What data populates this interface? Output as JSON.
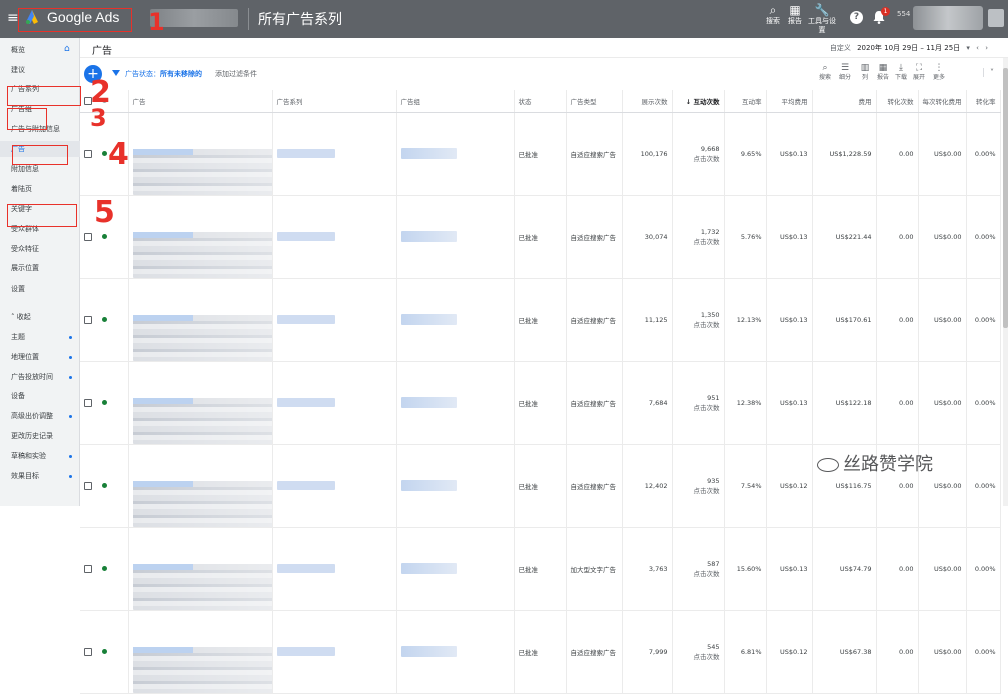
{
  "topbar": {
    "menu_glyph": "≡",
    "brand": "Google Ads",
    "page_title": "所有广告系列",
    "tools": [
      {
        "icon": "search-icon",
        "glyph": "⌕",
        "label": "搜索"
      },
      {
        "icon": "reports-icon",
        "glyph": "▦",
        "label": "报告"
      },
      {
        "icon": "wrench-icon",
        "glyph": "🔧",
        "label": "工具与设置"
      }
    ],
    "help_glyph": "?",
    "notification_count": "1",
    "customer_id_prefix": "554"
  },
  "sidebar": {
    "items": [
      {
        "label": "概览",
        "dot": false
      },
      {
        "label": "建议",
        "dot": false
      },
      {
        "label": "广告系列",
        "dot": false
      },
      {
        "label": "广告组",
        "dot": false
      },
      {
        "label": "广告与附加信息",
        "dot": false
      },
      {
        "label": "广告",
        "dot": false
      },
      {
        "label": "附加信息",
        "dot": false
      },
      {
        "label": "着陆页",
        "dot": false
      },
      {
        "label": "关键字",
        "dot": false
      },
      {
        "label": "受众群体",
        "dot": false
      },
      {
        "label": "受众特征",
        "dot": false
      },
      {
        "label": "展示位置",
        "dot": false
      },
      {
        "label": "设置",
        "dot": false
      },
      {
        "label": "˄ 收起",
        "dot": false
      },
      {
        "label": "主题",
        "dot": true
      },
      {
        "label": "地理位置",
        "dot": true
      },
      {
        "label": "广告投放时间",
        "dot": true
      },
      {
        "label": "设备",
        "dot": false
      },
      {
        "label": "高级出价调整",
        "dot": true
      },
      {
        "label": "更改历史记录",
        "dot": false
      },
      {
        "label": "草稿和实验",
        "dot": true
      },
      {
        "label": "效果目标",
        "dot": true
      }
    ]
  },
  "header": {
    "title": "广告",
    "date_label": "自定义",
    "date_range": "2020年 10月 29日 – 11月 25日",
    "date_dropdown": "▾",
    "prev": "‹",
    "next": "›"
  },
  "filters": {
    "add_glyph": "+",
    "status_label": "广告状态：",
    "status_value": "所有未移除的",
    "add_filter": "添加过滤条件"
  },
  "toolbar": [
    {
      "icon": "search-icon",
      "glyph": "⌕",
      "label": "搜索"
    },
    {
      "icon": "segment-icon",
      "glyph": "☰",
      "label": "细分"
    },
    {
      "icon": "columns-icon",
      "glyph": "▥",
      "label": "列"
    },
    {
      "icon": "reports-icon",
      "glyph": "▦",
      "label": "报告"
    },
    {
      "icon": "download-icon",
      "glyph": "⤓",
      "label": "下载"
    },
    {
      "icon": "expand-icon",
      "glyph": "⛶",
      "label": "展开"
    },
    {
      "icon": "more-icon",
      "glyph": "⋮",
      "label": "更多"
    }
  ],
  "collapse_glyph": "˅",
  "table": {
    "headers": [
      "广告",
      "广告系列",
      "广告组",
      "状态",
      "广告类型",
      "展示次数",
      "↓ 互动次数",
      "互动率",
      "平均费用",
      "费用",
      "转化次数",
      "每次转化费用",
      "转化率"
    ],
    "rows": [
      {
        "status": "已批准",
        "type": "自适应搜索广告",
        "impr": "100,176",
        "inter": "9,668",
        "inter_type": "点击次数",
        "rate": "9.65%",
        "avg": "US$0.13",
        "cost": "US$1,228.59",
        "conv": "0.00",
        "cpc": "US$0.00",
        "cr": "0.00%"
      },
      {
        "status": "已批准",
        "type": "自适应搜索广告",
        "impr": "30,074",
        "inter": "1,732",
        "inter_type": "点击次数",
        "rate": "5.76%",
        "avg": "US$0.13",
        "cost": "US$221.44",
        "conv": "0.00",
        "cpc": "US$0.00",
        "cr": "0.00%"
      },
      {
        "status": "已批准",
        "type": "自适应搜索广告",
        "impr": "11,125",
        "inter": "1,350",
        "inter_type": "点击次数",
        "rate": "12.13%",
        "avg": "US$0.13",
        "cost": "US$170.61",
        "conv": "0.00",
        "cpc": "US$0.00",
        "cr": "0.00%"
      },
      {
        "status": "已批准",
        "type": "自适应搜索广告",
        "impr": "7,684",
        "inter": "951",
        "inter_type": "点击次数",
        "rate": "12.38%",
        "avg": "US$0.13",
        "cost": "US$122.18",
        "conv": "0.00",
        "cpc": "US$0.00",
        "cr": "0.00%"
      },
      {
        "status": "已批准",
        "type": "自适应搜索广告",
        "impr": "12,402",
        "inter": "935",
        "inter_type": "点击次数",
        "rate": "7.54%",
        "avg": "US$0.12",
        "cost": "US$116.75",
        "conv": "0.00",
        "cpc": "US$0.00",
        "cr": "0.00%"
      },
      {
        "status": "已批准",
        "type": "加大型文字广告",
        "impr": "3,763",
        "inter": "587",
        "inter_type": "点击次数",
        "rate": "15.60%",
        "avg": "US$0.13",
        "cost": "US$74.79",
        "conv": "0.00",
        "cpc": "US$0.00",
        "cr": "0.00%"
      },
      {
        "status": "已批准",
        "type": "自适应搜索广告",
        "impr": "7,999",
        "inter": "545",
        "inter_type": "点击次数",
        "rate": "6.81%",
        "avg": "US$0.12",
        "cost": "US$67.38",
        "conv": "0.00",
        "cpc": "US$0.00",
        "cr": "0.00%"
      }
    ]
  },
  "annotations": [
    "1",
    "2",
    "3",
    "4",
    "5"
  ],
  "watermark": "丝路赞学院",
  "colors": {
    "topbar": "#5f6368",
    "accent": "#1a73e8",
    "annotation": "#e8312a",
    "enabled": "#188038"
  }
}
